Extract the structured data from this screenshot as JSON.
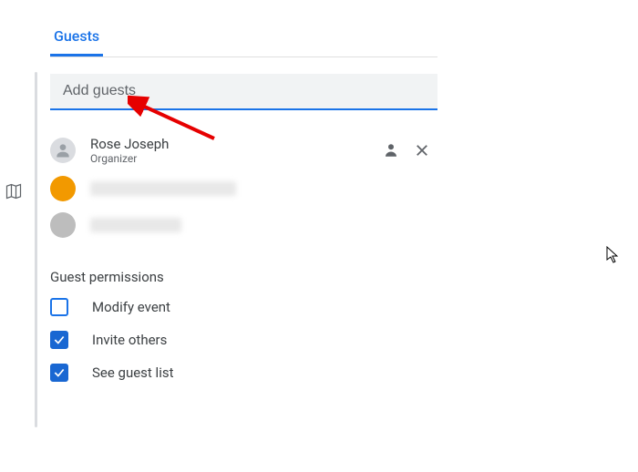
{
  "tab": {
    "label": "Guests"
  },
  "input": {
    "placeholder": "Add guests",
    "value": ""
  },
  "guests": [
    {
      "name": "Rose Joseph",
      "role": "Organizer"
    }
  ],
  "permissions": {
    "heading": "Guest permissions",
    "items": [
      {
        "label": "Modify event",
        "checked": false
      },
      {
        "label": "Invite others",
        "checked": true
      },
      {
        "label": "See guest list",
        "checked": true
      }
    ]
  },
  "icons": {
    "person": "person-icon",
    "close": "close-icon"
  }
}
